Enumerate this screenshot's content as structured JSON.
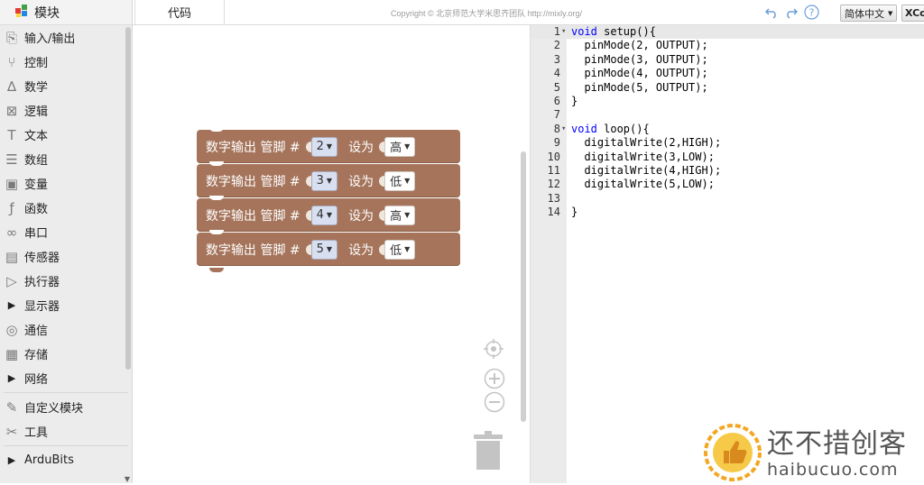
{
  "sidebar": {
    "title": "模块",
    "items": [
      {
        "label": "输入/输出",
        "icon": "input-output-icon"
      },
      {
        "label": "控制",
        "icon": "control-icon"
      },
      {
        "label": "数学",
        "icon": "math-icon"
      },
      {
        "label": "逻辑",
        "icon": "logic-icon"
      },
      {
        "label": "文本",
        "icon": "text-icon"
      },
      {
        "label": "数组",
        "icon": "array-icon"
      },
      {
        "label": "变量",
        "icon": "variable-icon"
      },
      {
        "label": "函数",
        "icon": "function-icon"
      },
      {
        "label": "串口",
        "icon": "serial-icon"
      },
      {
        "label": "传感器",
        "icon": "sensor-icon"
      },
      {
        "label": "执行器",
        "icon": "actuator-icon"
      },
      {
        "label": "显示器",
        "icon": "expand-triangle-icon"
      },
      {
        "label": "通信",
        "icon": "communication-icon"
      },
      {
        "label": "存储",
        "icon": "storage-icon"
      },
      {
        "label": "网络",
        "icon": "expand-triangle-icon"
      },
      {
        "label": "自定义模块",
        "icon": "custom-module-icon"
      },
      {
        "label": "工具",
        "icon": "tools-icon"
      },
      {
        "label": "ArduBits",
        "icon": "expand-triangle-icon"
      }
    ]
  },
  "topbar": {
    "code_tab": "代码",
    "copyright": "Copyright © 北京师范大学米思齐团队 http://mixly.org/",
    "language": "简体中文",
    "xcode": "XCode"
  },
  "blocks": [
    {
      "label": "数字输出 管脚 #",
      "pin": "2",
      "set_label": "设为",
      "value": "高"
    },
    {
      "label": "数字输出 管脚 #",
      "pin": "3",
      "set_label": "设为",
      "value": "低"
    },
    {
      "label": "数字输出 管脚 #",
      "pin": "4",
      "set_label": "设为",
      "value": "高"
    },
    {
      "label": "数字输出 管脚 #",
      "pin": "5",
      "set_label": "设为",
      "value": "低"
    }
  ],
  "code": {
    "lines": [
      {
        "n": "1",
        "fold": true,
        "text": "void setup(){"
      },
      {
        "n": "2",
        "fold": false,
        "text": "  pinMode(2, OUTPUT);"
      },
      {
        "n": "3",
        "fold": false,
        "text": "  pinMode(3, OUTPUT);"
      },
      {
        "n": "4",
        "fold": false,
        "text": "  pinMode(4, OUTPUT);"
      },
      {
        "n": "5",
        "fold": false,
        "text": "  pinMode(5, OUTPUT);"
      },
      {
        "n": "6",
        "fold": false,
        "text": "}"
      },
      {
        "n": "7",
        "fold": false,
        "text": ""
      },
      {
        "n": "8",
        "fold": true,
        "text": "void loop(){"
      },
      {
        "n": "9",
        "fold": false,
        "text": "  digitalWrite(2,HIGH);"
      },
      {
        "n": "10",
        "fold": false,
        "text": "  digitalWrite(3,LOW);"
      },
      {
        "n": "11",
        "fold": false,
        "text": "  digitalWrite(4,HIGH);"
      },
      {
        "n": "12",
        "fold": false,
        "text": "  digitalWrite(5,LOW);"
      },
      {
        "n": "13",
        "fold": false,
        "text": ""
      },
      {
        "n": "14",
        "fold": false,
        "text": "}"
      }
    ]
  },
  "watermark": {
    "cn": "还不措创客",
    "en": "haibucuo.com"
  },
  "colors": {
    "block": "#a5745b",
    "keyword": "#0000ff",
    "sidebar_bg": "#ececec",
    "gutter_bg": "#ebebeb"
  }
}
